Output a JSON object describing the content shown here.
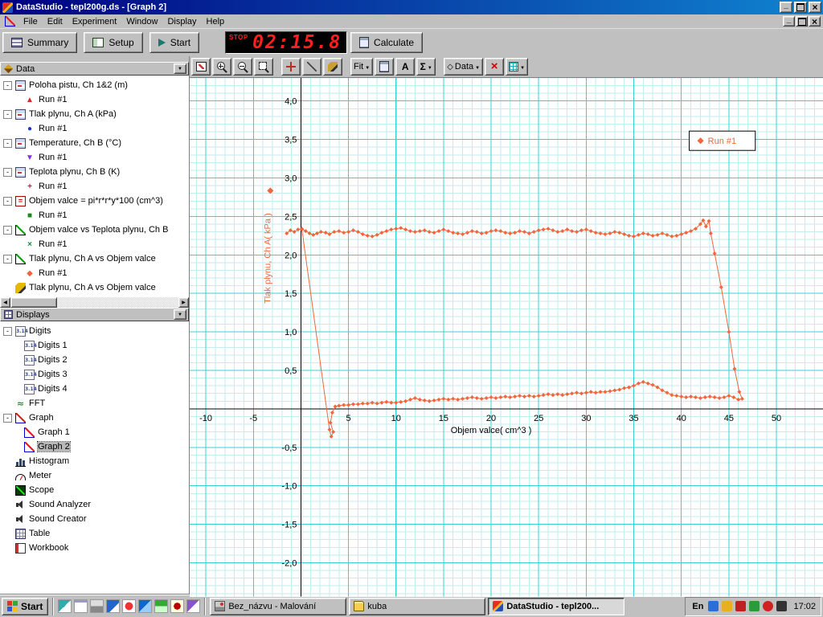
{
  "window": {
    "title": "DataStudio - tepl200g.ds - [Graph 2]"
  },
  "menu": {
    "items": [
      "File",
      "Edit",
      "Experiment",
      "Window",
      "Display",
      "Help"
    ]
  },
  "toolbar": {
    "summary": "Summary",
    "setup": "Setup",
    "start": "Start",
    "calculate": "Calculate",
    "timer": {
      "status": "STOP",
      "value": "02:15.8"
    }
  },
  "graph_toolbar": {
    "fit_label": "Fit",
    "text_tool_label": "A",
    "statistics_label": "Σ",
    "data_label": "Data"
  },
  "data_panel": {
    "title": "Data",
    "items": [
      {
        "label": "Poloha pistu, Ch 1&2 (m)",
        "icon": "sensor",
        "expand": true,
        "name": "data-item-poloha-pistu"
      },
      {
        "label": "Run #1",
        "marker": "▲",
        "color": "#d42a2a",
        "level": 1,
        "name": "run-item"
      },
      {
        "label": "Tlak plynu, Ch A (kPa)",
        "icon": "sensor",
        "expand": true,
        "name": "data-item-tlak-plynu"
      },
      {
        "label": "Run #1",
        "marker": "●",
        "color": "#2233cc",
        "level": 1,
        "name": "run-item"
      },
      {
        "label": "Temperature, Ch B (°C)",
        "icon": "sensor",
        "expand": true,
        "name": "data-item-temperature"
      },
      {
        "label": "Run #1",
        "marker": "▼",
        "color": "#8a2be2",
        "level": 1,
        "name": "run-item"
      },
      {
        "label": "Teplota plynu, Ch B (K)",
        "icon": "sensor",
        "expand": true,
        "name": "data-item-teplota-plynu"
      },
      {
        "label": "Run #1",
        "marker": "+",
        "color": "#cc1144",
        "level": 1,
        "name": "run-item"
      },
      {
        "label": "Objem valce = pi*r*r*y*100 (cm^3)",
        "icon": "calc",
        "expand": true,
        "name": "data-item-objem-valce"
      },
      {
        "label": "Run #1",
        "marker": "■",
        "color": "#1a8a1a",
        "level": 1,
        "name": "run-item"
      },
      {
        "label": "Objem valce vs Teplota plynu, Ch B",
        "icon": "xy",
        "expand": true,
        "name": "data-item-objem-vs-teplota"
      },
      {
        "label": "Run #1",
        "marker": "×",
        "color": "#1a8a3a",
        "level": 1,
        "name": "run-item"
      },
      {
        "label": "Tlak plynu, Ch A vs Objem valce",
        "icon": "xy",
        "expand": true,
        "name": "data-item-tlak-vs-objem"
      },
      {
        "label": "Run #1",
        "marker": "◆",
        "color": "#f2663c",
        "level": 1,
        "name": "run-item"
      },
      {
        "label": "Tlak plynu, Ch A vs Objem valce",
        "icon": "pencil",
        "name": "data-item-tlak-vs-objem-2"
      }
    ]
  },
  "displays_panel": {
    "title": "Displays",
    "items": [
      {
        "label": "Digits",
        "icon": "digits",
        "expand": true,
        "name": "display-item-digits"
      },
      {
        "label": "Digits 1",
        "icon": "digits",
        "level": 1,
        "name": "display-item-digits-1"
      },
      {
        "label": "Digits 2",
        "icon": "digits",
        "level": 1,
        "name": "display-item-digits-2"
      },
      {
        "label": "Digits 3",
        "icon": "digits",
        "level": 1,
        "name": "display-item-digits-3"
      },
      {
        "label": "Digits 4",
        "icon": "digits",
        "level": 1,
        "name": "display-item-digits-4"
      },
      {
        "label": "FFT",
        "icon": "fft",
        "name": "display-item-fft"
      },
      {
        "label": "Graph",
        "icon": "graphico",
        "expand": true,
        "name": "display-item-graph"
      },
      {
        "label": "Graph 1",
        "icon": "graphico",
        "level": 1,
        "name": "display-item-graph-1"
      },
      {
        "label": "Graph 2",
        "icon": "graphico",
        "level": 1,
        "selected": true,
        "name": "display-item-graph-2"
      },
      {
        "label": "Histogram",
        "icon": "histogram",
        "name": "display-item-histogram"
      },
      {
        "label": "Meter",
        "icon": "meter",
        "name": "display-item-meter"
      },
      {
        "label": "Scope",
        "icon": "scope",
        "name": "display-item-scope"
      },
      {
        "label": "Sound Analyzer",
        "icon": "speaker",
        "name": "display-item-sound-analyzer"
      },
      {
        "label": "Sound Creator",
        "icon": "speaker",
        "name": "display-item-sound-creator"
      },
      {
        "label": "Table",
        "icon": "table",
        "name": "display-item-table"
      },
      {
        "label": "Workbook",
        "icon": "workbook",
        "name": "display-item-workbook"
      }
    ]
  },
  "taskbar": {
    "start_label": "Start",
    "tasks": [
      {
        "label": "Bez_názvu - Malování"
      },
      {
        "label": "kuba"
      },
      {
        "label": "DataStudio - tepl200...",
        "active": true
      }
    ],
    "tray": {
      "language": "En",
      "time": "17:02"
    }
  },
  "chart_data": {
    "type": "scatter",
    "title": "",
    "xlabel": "Objem valce( cm^3 )",
    "ylabel": "Tlak plynu, Ch A( kPa )",
    "xlim": [
      -11.7,
      54.9
    ],
    "ylim": [
      -2.44,
      4.3
    ],
    "grid": {
      "on": true,
      "minor_x": 1,
      "minor_y": 0.1,
      "major_x": 5,
      "major_y": 0.5,
      "minor_color": "#c2eeee",
      "major_color": "#3bd0d0"
    },
    "x_ticks": [
      {
        "v": -10,
        "label": "-10"
      },
      {
        "v": -5,
        "label": "-5"
      },
      {
        "v": 5,
        "label": "5"
      },
      {
        "v": 10,
        "label": "10"
      },
      {
        "v": 15,
        "label": "15"
      },
      {
        "v": 20,
        "label": "20"
      },
      {
        "v": 25,
        "label": "25"
      },
      {
        "v": 30,
        "label": "30"
      },
      {
        "v": 35,
        "label": "35"
      },
      {
        "v": 40,
        "label": "40"
      },
      {
        "v": 45,
        "label": "45"
      },
      {
        "v": 50,
        "label": "50"
      }
    ],
    "y_ticks": [
      {
        "v": 4,
        "label": "4,0"
      },
      {
        "v": 3.5,
        "label": "3,5"
      },
      {
        "v": 3,
        "label": "3,0"
      },
      {
        "v": 2.5,
        "label": "2,5"
      },
      {
        "v": 2,
        "label": "2,0"
      },
      {
        "v": 1.5,
        "label": "1,5"
      },
      {
        "v": 1,
        "label": "1,0"
      },
      {
        "v": 0.5,
        "label": "0,5"
      },
      {
        "v": -0.5,
        "label": "-0,5"
      },
      {
        "v": -1,
        "label": "-1,0"
      },
      {
        "v": -1.5,
        "label": "-1,5"
      },
      {
        "v": -2,
        "label": "-2,0"
      }
    ],
    "legend": {
      "label": "Run #1",
      "position": "top-right"
    },
    "series": [
      {
        "name": "Run #1",
        "color": "#f2663c",
        "marker": "diamond",
        "points": [
          [
            -1.5,
            2.28
          ],
          [
            -1.1,
            2.32
          ],
          [
            -0.7,
            2.3
          ],
          [
            -0.3,
            2.33
          ],
          [
            0.1,
            2.34
          ],
          [
            0.5,
            2.31
          ],
          [
            0.9,
            2.28
          ],
          [
            1.3,
            2.26
          ],
          [
            1.7,
            2.28
          ],
          [
            2.1,
            2.3
          ],
          [
            2.6,
            2.29
          ],
          [
            3,
            2.27
          ],
          [
            3.5,
            2.3
          ],
          [
            4,
            2.31
          ],
          [
            4.5,
            2.29
          ],
          [
            5,
            2.3
          ],
          [
            5.5,
            2.32
          ],
          [
            6,
            2.3
          ],
          [
            6.5,
            2.27
          ],
          [
            7,
            2.25
          ],
          [
            7.5,
            2.24
          ],
          [
            8,
            2.26
          ],
          [
            8.5,
            2.29
          ],
          [
            9,
            2.31
          ],
          [
            9.5,
            2.33
          ],
          [
            10,
            2.34
          ],
          [
            10.5,
            2.35
          ],
          [
            11,
            2.33
          ],
          [
            11.5,
            2.31
          ],
          [
            12,
            2.3
          ],
          [
            12.5,
            2.31
          ],
          [
            13,
            2.32
          ],
          [
            13.5,
            2.3
          ],
          [
            14,
            2.29
          ],
          [
            14.5,
            2.31
          ],
          [
            15,
            2.33
          ],
          [
            15.5,
            2.31
          ],
          [
            16,
            2.29
          ],
          [
            16.5,
            2.28
          ],
          [
            17,
            2.27
          ],
          [
            17.5,
            2.29
          ],
          [
            18,
            2.31
          ],
          [
            18.5,
            2.3
          ],
          [
            19,
            2.28
          ],
          [
            19.5,
            2.29
          ],
          [
            20,
            2.31
          ],
          [
            20.5,
            2.32
          ],
          [
            21,
            2.31
          ],
          [
            21.5,
            2.29
          ],
          [
            22,
            2.28
          ],
          [
            22.5,
            2.29
          ],
          [
            23,
            2.31
          ],
          [
            23.5,
            2.3
          ],
          [
            24,
            2.28
          ],
          [
            24.5,
            2.3
          ],
          [
            25,
            2.32
          ],
          [
            25.5,
            2.33
          ],
          [
            26,
            2.34
          ],
          [
            26.5,
            2.32
          ],
          [
            27,
            2.3
          ],
          [
            27.5,
            2.31
          ],
          [
            28,
            2.33
          ],
          [
            28.5,
            2.31
          ],
          [
            29,
            2.3
          ],
          [
            29.5,
            2.32
          ],
          [
            30,
            2.33
          ],
          [
            30.5,
            2.31
          ],
          [
            31,
            2.29
          ],
          [
            31.5,
            2.28
          ],
          [
            32,
            2.27
          ],
          [
            32.5,
            2.28
          ],
          [
            33,
            2.3
          ],
          [
            33.5,
            2.29
          ],
          [
            34,
            2.27
          ],
          [
            34.5,
            2.25
          ],
          [
            35,
            2.24
          ],
          [
            35.5,
            2.26
          ],
          [
            36,
            2.28
          ],
          [
            36.5,
            2.27
          ],
          [
            37,
            2.25
          ],
          [
            37.5,
            2.26
          ],
          [
            38,
            2.28
          ],
          [
            38.5,
            2.26
          ],
          [
            39,
            2.24
          ],
          [
            39.5,
            2.25
          ],
          [
            40,
            2.27
          ],
          [
            40.5,
            2.29
          ],
          [
            41,
            2.31
          ],
          [
            41.5,
            2.34
          ],
          [
            42,
            2.4
          ],
          [
            42.3,
            2.45
          ],
          [
            42.6,
            2.37
          ],
          [
            42.9,
            2.44
          ],
          [
            43.1,
            2.28
          ],
          [
            43.5,
            2.02
          ],
          [
            44.2,
            1.58
          ],
          [
            45,
            1
          ],
          [
            45.6,
            0.52
          ],
          [
            46.1,
            0.22
          ],
          [
            46.4,
            0.13
          ],
          [
            46,
            0.12
          ],
          [
            45.5,
            0.15
          ],
          [
            45,
            0.17
          ],
          [
            44.5,
            0.15
          ],
          [
            44,
            0.14
          ],
          [
            43.5,
            0.15
          ],
          [
            43,
            0.16
          ],
          [
            42.5,
            0.15
          ],
          [
            42,
            0.14
          ],
          [
            41.5,
            0.15
          ],
          [
            41,
            0.16
          ],
          [
            40.5,
            0.15
          ],
          [
            40,
            0.16
          ],
          [
            39.5,
            0.17
          ],
          [
            39,
            0.18
          ],
          [
            38.5,
            0.21
          ],
          [
            38,
            0.24
          ],
          [
            37.5,
            0.28
          ],
          [
            37,
            0.31
          ],
          [
            36.5,
            0.33
          ],
          [
            36,
            0.35
          ],
          [
            35.5,
            0.33
          ],
          [
            35,
            0.3
          ],
          [
            34.5,
            0.28
          ],
          [
            34,
            0.27
          ],
          [
            33.5,
            0.25
          ],
          [
            33,
            0.24
          ],
          [
            32.5,
            0.23
          ],
          [
            32,
            0.22
          ],
          [
            31.5,
            0.22
          ],
          [
            31,
            0.21
          ],
          [
            30.5,
            0.22
          ],
          [
            30,
            0.21
          ],
          [
            29.5,
            0.2
          ],
          [
            29,
            0.21
          ],
          [
            28.5,
            0.2
          ],
          [
            28,
            0.19
          ],
          [
            27.5,
            0.18
          ],
          [
            27,
            0.19
          ],
          [
            26.5,
            0.18
          ],
          [
            26,
            0.19
          ],
          [
            25.5,
            0.18
          ],
          [
            25,
            0.17
          ],
          [
            24.5,
            0.16
          ],
          [
            24,
            0.17
          ],
          [
            23.5,
            0.16
          ],
          [
            23,
            0.17
          ],
          [
            22.5,
            0.16
          ],
          [
            22,
            0.15
          ],
          [
            21.5,
            0.16
          ],
          [
            21,
            0.15
          ],
          [
            20.5,
            0.14
          ],
          [
            20,
            0.15
          ],
          [
            19.5,
            0.14
          ],
          [
            19,
            0.13
          ],
          [
            18.5,
            0.14
          ],
          [
            18,
            0.15
          ],
          [
            17.5,
            0.14
          ],
          [
            17,
            0.13
          ],
          [
            16.5,
            0.12
          ],
          [
            16,
            0.13
          ],
          [
            15.5,
            0.12
          ],
          [
            15,
            0.13
          ],
          [
            14.5,
            0.12
          ],
          [
            14,
            0.11
          ],
          [
            13.5,
            0.1
          ],
          [
            13,
            0.11
          ],
          [
            12.5,
            0.12
          ],
          [
            12,
            0.14
          ],
          [
            11.5,
            0.12
          ],
          [
            11,
            0.1
          ],
          [
            10.5,
            0.09
          ],
          [
            10,
            0.08
          ],
          [
            9.5,
            0.08
          ],
          [
            9,
            0.09
          ],
          [
            8.5,
            0.08
          ],
          [
            8,
            0.07
          ],
          [
            7.5,
            0.08
          ],
          [
            7,
            0.07
          ],
          [
            6.5,
            0.07
          ],
          [
            6,
            0.06
          ],
          [
            5.5,
            0.06
          ],
          [
            5,
            0.05
          ],
          [
            4.5,
            0.05
          ],
          [
            4,
            0.04
          ],
          [
            3.6,
            0.03
          ],
          [
            3.3,
            -0.05
          ],
          [
            3.1,
            -0.18
          ],
          [
            3.4,
            -0.3
          ],
          [
            3.2,
            -0.36
          ],
          [
            3,
            -0.27
          ],
          [
            0.1,
            2.33
          ]
        ]
      }
    ]
  }
}
